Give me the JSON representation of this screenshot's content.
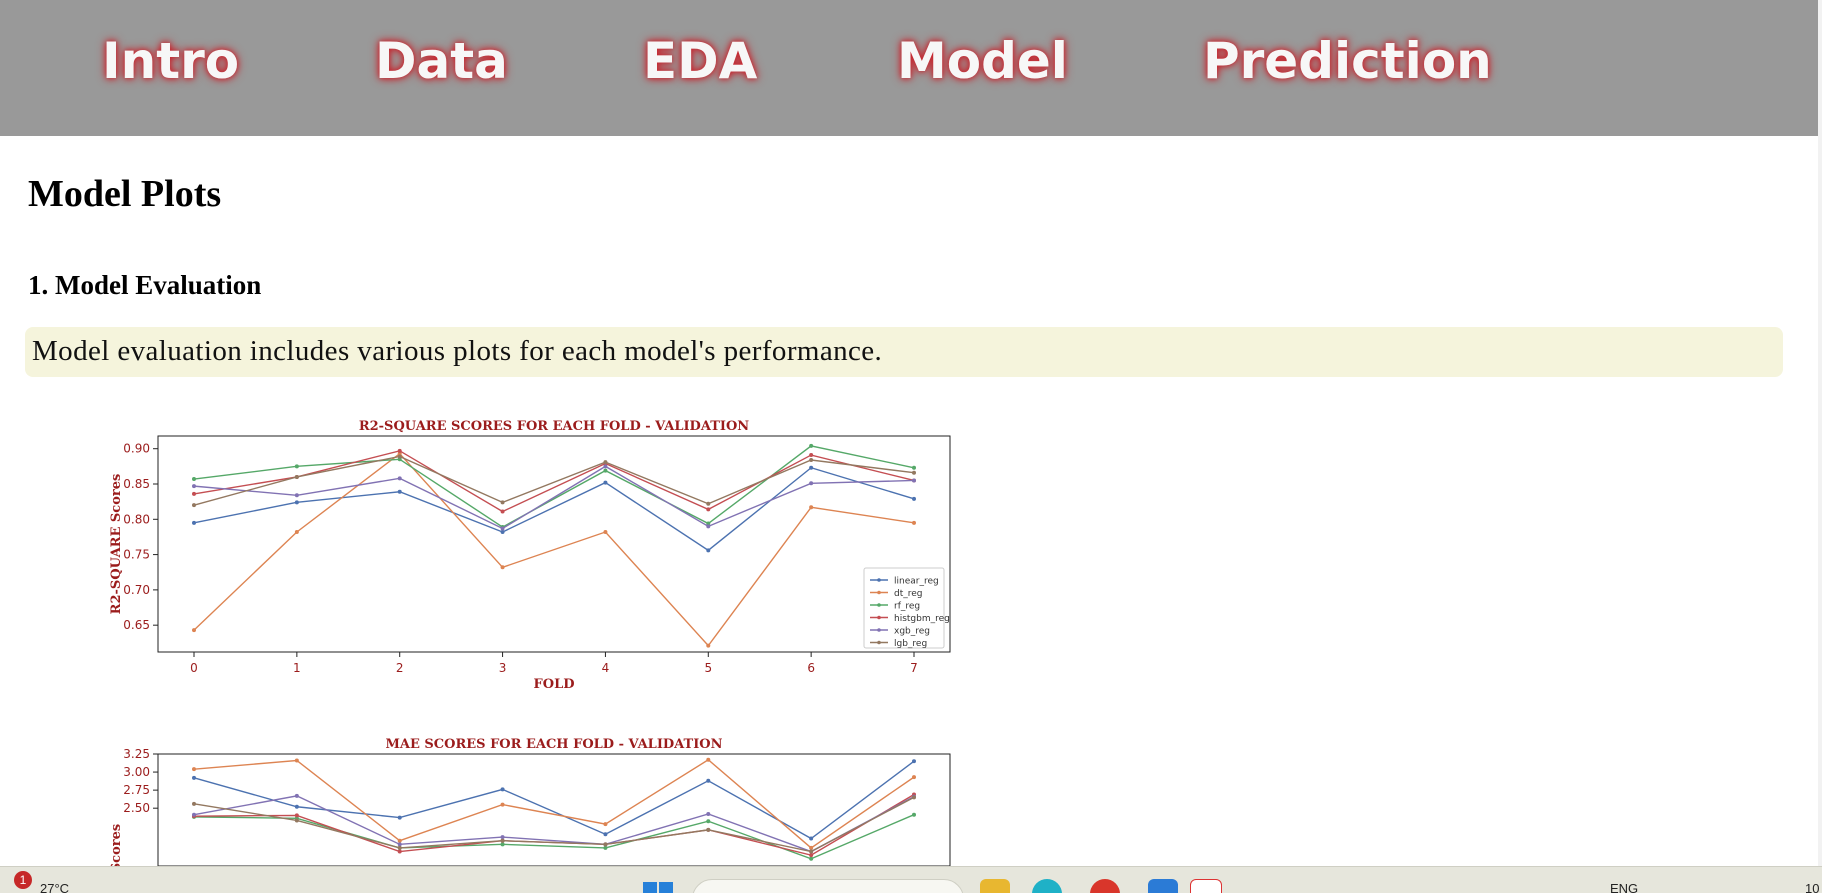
{
  "nav": {
    "items": [
      "Intro",
      "Data",
      "EDA",
      "Model",
      "Prediction"
    ]
  },
  "page": {
    "title": "Model Plots",
    "section_title": "1. Model Evaluation",
    "info_text": "Model evaluation includes various plots for each model's performance."
  },
  "colors": {
    "nav_bg": "#999999",
    "nav_glow": "#c8232c",
    "info_bg": "#f5f4dc",
    "chart_text": "#9b1c1c"
  },
  "chart_data": [
    {
      "type": "line",
      "title": "R2-SQUARE SCORES FOR EACH FOLD - VALIDATION",
      "xlabel": "FOLD",
      "ylabel": "R2-SQUARE Scores",
      "x": [
        0,
        1,
        2,
        3,
        4,
        5,
        6,
        7
      ],
      "xlim": [
        -0.35,
        7.35
      ],
      "ylim": [
        0.612,
        0.918
      ],
      "yticks": [
        0.65,
        0.7,
        0.75,
        0.8,
        0.85,
        0.9
      ],
      "ytick_labels": [
        "0.65",
        "0.70",
        "0.75",
        "0.80",
        "0.85",
        "0.90"
      ],
      "legend_position": "lower-right",
      "grid": false,
      "series": [
        {
          "name": "linear_reg",
          "color": "#4c72b0",
          "values": [
            0.795,
            0.824,
            0.839,
            0.782,
            0.852,
            0.756,
            0.873,
            0.829
          ]
        },
        {
          "name": "dt_reg",
          "color": "#dd8452",
          "values": [
            0.643,
            0.782,
            0.893,
            0.732,
            0.782,
            0.621,
            0.817,
            0.795
          ]
        },
        {
          "name": "rf_reg",
          "color": "#55a868",
          "values": [
            0.857,
            0.875,
            0.885,
            0.789,
            0.869,
            0.794,
            0.904,
            0.873
          ]
        },
        {
          "name": "histgbm_reg",
          "color": "#c44e52",
          "values": [
            0.836,
            0.86,
            0.897,
            0.811,
            0.879,
            0.814,
            0.891,
            0.855
          ]
        },
        {
          "name": "xgb_reg",
          "color": "#8172b3",
          "values": [
            0.847,
            0.834,
            0.858,
            0.787,
            0.875,
            0.79,
            0.851,
            0.855
          ]
        },
        {
          "name": "lgb_reg",
          "color": "#937860",
          "values": [
            0.82,
            0.86,
            0.889,
            0.824,
            0.881,
            0.822,
            0.884,
            0.866
          ]
        }
      ]
    },
    {
      "type": "line",
      "title": "MAE SCORES FOR EACH FOLD - VALIDATION",
      "xlabel": "",
      "ylabel": "Scores",
      "x": [
        0,
        1,
        2,
        3,
        4,
        5,
        6,
        7
      ],
      "xlim": [
        -0.35,
        7.35
      ],
      "ylim": [
        1.7,
        3.25
      ],
      "yticks": [
        2.5,
        2.75,
        3.0,
        3.25
      ],
      "ytick_labels": [
        "2.50",
        "2.75",
        "3.00",
        "3.25"
      ],
      "grid": false,
      "series": [
        {
          "name": "linear_reg",
          "color": "#4c72b0",
          "values": [
            2.92,
            2.52,
            2.37,
            2.76,
            2.14,
            2.88,
            2.08,
            3.15
          ]
        },
        {
          "name": "dt_reg",
          "color": "#dd8452",
          "values": [
            3.04,
            3.16,
            2.05,
            2.55,
            2.28,
            3.17,
            1.95,
            2.93
          ]
        },
        {
          "name": "rf_reg",
          "color": "#55a868",
          "values": [
            2.38,
            2.36,
            1.95,
            2.0,
            1.95,
            2.32,
            1.8,
            2.41
          ]
        },
        {
          "name": "histgbm_reg",
          "color": "#c44e52",
          "values": [
            2.39,
            2.4,
            1.9,
            2.05,
            2.0,
            2.2,
            1.85,
            2.69
          ]
        },
        {
          "name": "xgb_reg",
          "color": "#8172b3",
          "values": [
            2.41,
            2.67,
            2.0,
            2.1,
            2.0,
            2.42,
            1.9,
            2.66
          ]
        },
        {
          "name": "lgb_reg",
          "color": "#937860",
          "values": [
            2.56,
            2.33,
            1.95,
            2.05,
            2.0,
            2.2,
            1.9,
            2.65
          ]
        }
      ]
    }
  ],
  "taskbar": {
    "notification_count": "1",
    "weather": "27°C",
    "language": "ENG",
    "time": "10"
  }
}
